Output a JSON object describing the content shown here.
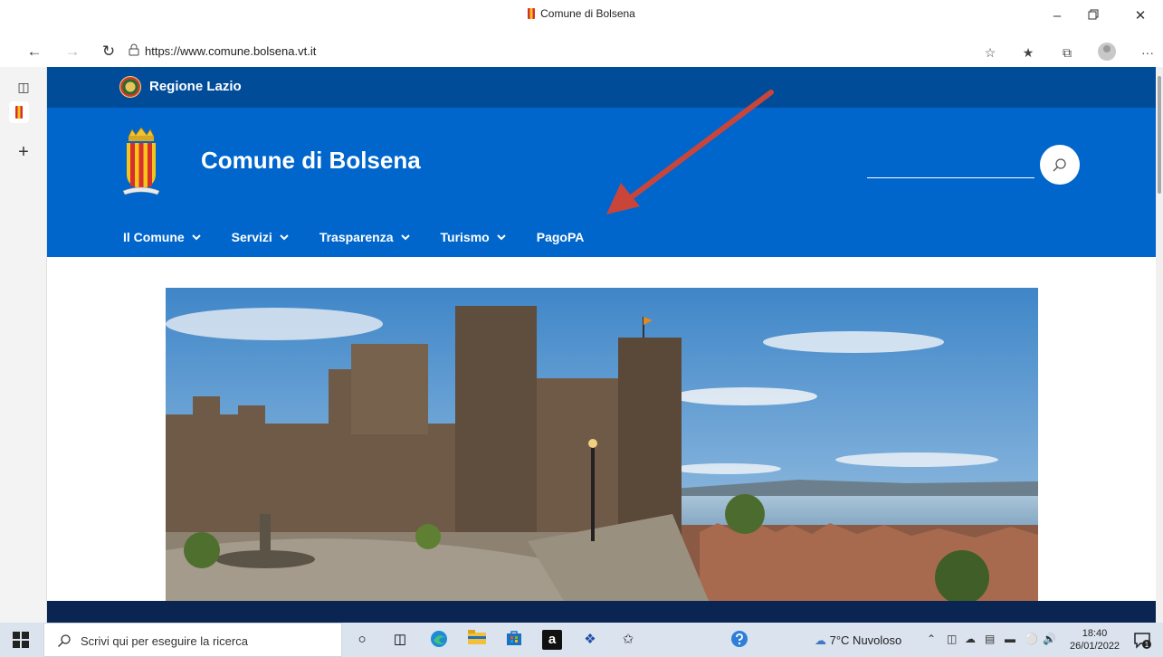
{
  "browser": {
    "window_title": "Comune di Bolsena",
    "url": "https://www.comune.bolsena.vt.it",
    "more_label": "···"
  },
  "site": {
    "region_name": "Regione Lazio",
    "title": "Comune di Bolsena",
    "nav": [
      {
        "label": "Il Comune",
        "has_dropdown": true
      },
      {
        "label": "Servizi",
        "has_dropdown": true
      },
      {
        "label": "Trasparenza",
        "has_dropdown": true
      },
      {
        "label": "Turismo",
        "has_dropdown": true
      },
      {
        "label": "PagoPA",
        "has_dropdown": false
      }
    ],
    "colors": {
      "region_bar": "#004c99",
      "header": "#0066cc",
      "footer": "#0a2551",
      "annotation_arrow": "#c9453a"
    }
  },
  "taskbar": {
    "search_placeholder": "Scrivi qui per eseguire la ricerca",
    "weather": "7°C  Nuvoloso",
    "time": "18:40",
    "date": "26/01/2022",
    "notification_count": "1"
  }
}
